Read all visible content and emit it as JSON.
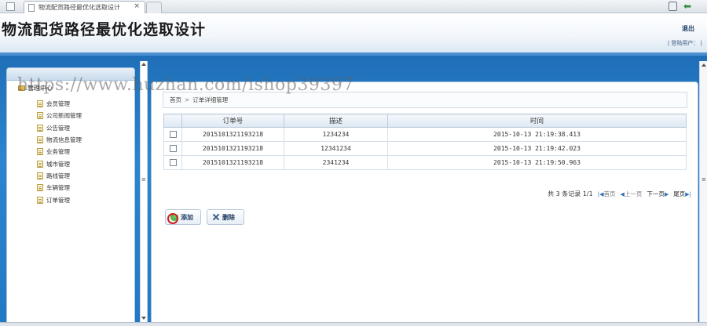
{
  "browser": {
    "tab_title": "物流配货路径最优化选取设计",
    "tab_close": "×"
  },
  "header": {
    "title": "物流配货路径最优化选取设计",
    "logout": "退出",
    "user_line": "| 登陆用户： |"
  },
  "sidebar": {
    "root_label": "管理中心",
    "items": [
      {
        "label": "会员管理"
      },
      {
        "label": "公司新闻管理"
      },
      {
        "label": "公告管理"
      },
      {
        "label": "物流信息管理"
      },
      {
        "label": "业务管理"
      },
      {
        "label": "城市管理"
      },
      {
        "label": "路线管理"
      },
      {
        "label": "车辆管理"
      },
      {
        "label": "订单管理"
      }
    ]
  },
  "breadcrumb": {
    "home": "首页",
    "separator": ">",
    "current": "订单详细管理"
  },
  "table": {
    "columns": [
      "订单号",
      "描述",
      "时间"
    ],
    "rows": [
      {
        "order_no": "2015101321193218",
        "desc": "1234234",
        "time": "2015-10-13 21:19:38.413"
      },
      {
        "order_no": "2015101321193218",
        "desc": "12341234",
        "time": "2015-10-13 21:19:42.023"
      },
      {
        "order_no": "2015101321193218",
        "desc": "2341234",
        "time": "2015-10-13 21:19:50.963"
      }
    ]
  },
  "pager": {
    "summary": "共 3 条记录 1/1",
    "first": "首页",
    "prev": "上一页",
    "next": "下一页",
    "last": "尾页"
  },
  "actions": {
    "add_label": "添加",
    "delete_label": "删除"
  },
  "watermark": "https://www.huzhan.com/ishop39397"
}
